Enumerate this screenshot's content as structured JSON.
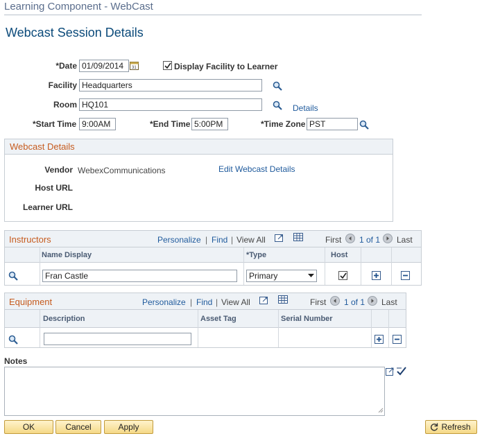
{
  "header": {
    "component_title": "Learning Component - WebCast",
    "page_title": "Webcast Session Details"
  },
  "form": {
    "date_label": "*Date",
    "date_value": "01/09/2014",
    "display_facility_label": "Display Facility to Learner",
    "display_facility_checked": true,
    "facility_label": "Facility",
    "facility_value": "Headquarters",
    "room_label": "Room",
    "room_value": "HQ101",
    "details_link": "Details",
    "start_time_label": "*Start Time",
    "start_time_value": "9:00AM",
    "end_time_label": "*End Time",
    "end_time_value": "5:00PM",
    "time_zone_label": "*Time Zone",
    "time_zone_value": "PST"
  },
  "webcast": {
    "title": "Webcast Details",
    "vendor_label": "Vendor",
    "vendor_value": "WebexCommunications",
    "edit_link": "Edit Webcast Details",
    "host_url_label": "Host URL",
    "learner_url_label": "Learner URL"
  },
  "instructors": {
    "title": "Instructors",
    "personalize": "Personalize",
    "find": "Find",
    "view_all": "View All",
    "sep": "|",
    "first": "First",
    "range": "1 of 1",
    "last": "Last",
    "columns": {
      "name": "Name Display",
      "type": "*Type",
      "host": "Host"
    },
    "row": {
      "name": "Fran Castle",
      "type": "Primary",
      "host": true
    }
  },
  "equipment": {
    "title": "Equipment",
    "personalize": "Personalize",
    "find": "Find",
    "view_all": "View All",
    "sep": "|",
    "first": "First",
    "range": "1 of 1",
    "last": "Last",
    "columns": {
      "description": "Description",
      "asset_tag": "Asset Tag",
      "serial": "Serial Number"
    },
    "row": {
      "description": "",
      "asset_tag": "",
      "serial": ""
    }
  },
  "notes": {
    "label": "Notes",
    "value": ""
  },
  "buttons": {
    "ok": "OK",
    "cancel": "Cancel",
    "apply": "Apply",
    "refresh": "Refresh"
  },
  "icons": {
    "calendar": "calendar-icon",
    "lookup": "magnifier-icon",
    "download": "download-icon",
    "grid": "grid-view-icon",
    "add": "add-row-icon",
    "remove": "delete-row-icon",
    "spell": "spellcheck-icon",
    "expand": "expand-notes-icon",
    "refresh": "refresh-icon"
  }
}
